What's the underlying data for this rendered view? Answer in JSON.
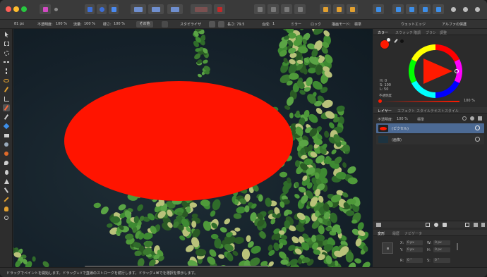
{
  "context_bar": {
    "size_value": "81 px",
    "opacity_label": "不透明度:",
    "opacity_value": "100 %",
    "flow_label": "流量:",
    "flow_value": "100 %",
    "hardness_label": "硬さ:",
    "hardness_value": "100 %",
    "more_label": "その他",
    "stabilize_label": "スタビライザ",
    "length_label": "長さ: 79.5",
    "blend_label": "合成:",
    "blend_value": "1",
    "mirror_label": "ミラー",
    "lock_label": "ロック",
    "wet_edge_label": "ウェットエッジ",
    "protect_alpha_label": "アルファの保護",
    "blend_mode_label": "描画モード:",
    "blend_mode_value": "標準"
  },
  "panel": {
    "color_tabs": [
      "カラー",
      "スウォッチ",
      "階調",
      "ブラシ",
      "調整"
    ],
    "hsl": {
      "h": "H: 0",
      "s": "S: 100",
      "l": "L: 50"
    },
    "opacity_label": "不透明度",
    "opacity_value": "100 %",
    "layer_tabs": [
      "レイヤー",
      "エフェクト",
      "スタイル",
      "テキストスタイル"
    ],
    "layer_opacity_label": "不透明度:",
    "layer_opacity_value": "100 %",
    "layer_mode_value": "標準",
    "layers": [
      {
        "name": "(ピクセル)",
        "selected": true,
        "thumb_color": "#ff1a00"
      },
      {
        "name": "(画像)",
        "selected": false,
        "thumb_color": "#1d3340"
      }
    ],
    "transform_tabs": [
      "変形",
      "履歴",
      "ナビゲータ"
    ],
    "transform": {
      "x_label": "X:",
      "x_value": "0 px",
      "y_label": "Y:",
      "y_value": "0 px",
      "w_label": "W:",
      "w_value": "0 px",
      "h_label": "H:",
      "h_value": "0 px",
      "r_label": "R:",
      "r_value": "0 °",
      "s_label": "S:",
      "s_value": "0 °"
    }
  },
  "status_bar": {
    "text": "ドラッグでペイントを開始します。ドラッグ+⇧で直線のストロークを続行します。ドラッグ+⌘でを選択を表示します。"
  },
  "colors": {
    "primary": "#ff1a00",
    "ellipse": "#ff1400",
    "selection": "#4c6a94"
  }
}
